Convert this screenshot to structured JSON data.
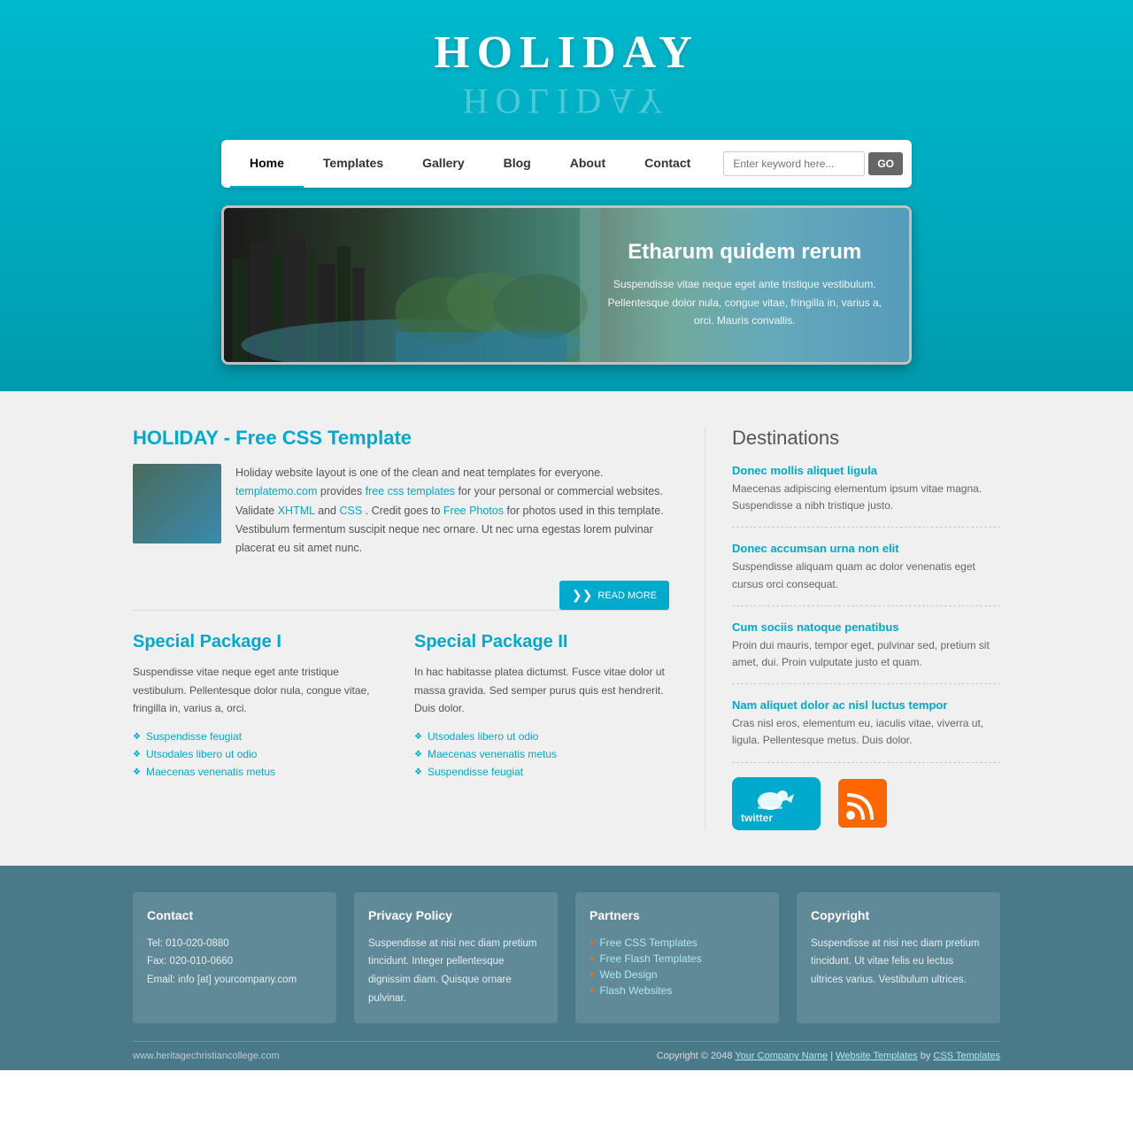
{
  "site": {
    "title": "HOLIDAY",
    "title_reflection": "HOLIDAY"
  },
  "nav": {
    "links": [
      {
        "label": "Home",
        "active": true
      },
      {
        "label": "Templates",
        "active": false
      },
      {
        "label": "Gallery",
        "active": false
      },
      {
        "label": "Blog",
        "active": false
      },
      {
        "label": "About",
        "active": false
      },
      {
        "label": "Contact",
        "active": false
      }
    ],
    "search_placeholder": "Enter keyword here...",
    "search_button": "GO"
  },
  "hero": {
    "heading": "Etharum quidem rerum",
    "body": "Suspendisse vitae neque eget ante tristique vestibulum. Pellentesque dolor nula, congue vitae, fringilla in, varius a, orci. Mauris convallis."
  },
  "article": {
    "title": "HOLIDAY - Free CSS Template",
    "text1": "Holiday website layout is one of the clean and neat templates for everyone.",
    "link1_text": "templatemo.com",
    "text2": " provides ",
    "link2_text": "free css templates",
    "text3": " for your personal or commercial websites. Validate ",
    "link3_text": "XHTML",
    "text4": " and ",
    "link4_text": "CSS",
    "text5": ". Credit goes to ",
    "link5_text": "Free Photos",
    "text6": " for photos used in this template. Vestibulum fermentum suscipit neque nec ornare. Ut nec urna egestas lorem pulvinar placerat eu sit amet nunc.",
    "read_more": "READ MORE"
  },
  "packages": [
    {
      "title": "Special Package I",
      "text": "Suspendisse vitae neque eget ante tristique vestibulum. Pellentesque dolor nula, congue vitae, fringilla in, varius a, orci.",
      "links": [
        "Suspendisse feugiat",
        "Utsodales libero ut odio",
        "Maecenas venenatis metus"
      ]
    },
    {
      "title": "Special Package II",
      "text": "In hac habitasse platea dictumst. Fusce vitae dolor ut massa gravida. Sed semper purus quis est hendrerit. Duis dolor.",
      "links": [
        "Utsodales libero ut odio",
        "Maecenas venenatis metus",
        "Suspendisse feugiat"
      ]
    }
  ],
  "destinations": {
    "title": "Destinations",
    "items": [
      {
        "title": "Donec mollis aliquet ligula",
        "text": "Maecenas adipiscing elementum ipsum vitae magna. Suspendisse a nibh tristique justo."
      },
      {
        "title": "Donec accumsan urna non elit",
        "text": "Suspendisse aliquam quam ac dolor venenatis eget cursus orci consequat."
      },
      {
        "title": "Cum sociis natoque penatibus",
        "text": "Proin dui mauris, tempor eget, pulvinar sed, pretium sit amet, dui. Proin vulputate justo et quam."
      },
      {
        "title": "Nam aliquet dolor ac nisl luctus tempor",
        "text": "Cras nisl eros, elementum eu, iaculis vitae, viverra ut, ligula. Pellentesque metus. Duis dolor."
      }
    ]
  },
  "footer": {
    "cols": [
      {
        "title": "Contact",
        "lines": [
          "Tel: 010-020-0880",
          "Fax: 020-010-0660",
          "Email: info [at] yourcompany.com"
        ]
      },
      {
        "title": "Privacy Policy",
        "text": "Suspendisse at nisi nec diam pretium tincidunt. Integer pellentesque dignissim diam. Quisque ornare pulvinar."
      },
      {
        "title": "Partners",
        "links": [
          "Free CSS Templates",
          "Free Flash Templates",
          "Web Design",
          "Flash Websites"
        ]
      },
      {
        "title": "Copyright",
        "text": "Suspendisse at nisi nec diam pretium tincidunt. Ut vitae felis eu lectus ultrices varius. Vestibulum ultrices."
      }
    ],
    "bottom_left": "www.heritagechristiancollege.com",
    "copyright_text": "Copyright © 2048",
    "your_company": "Your Company Name",
    "separator1": "|",
    "website_templates": "Website Templates",
    "by": "by",
    "css_templates": "CSS Templates"
  }
}
